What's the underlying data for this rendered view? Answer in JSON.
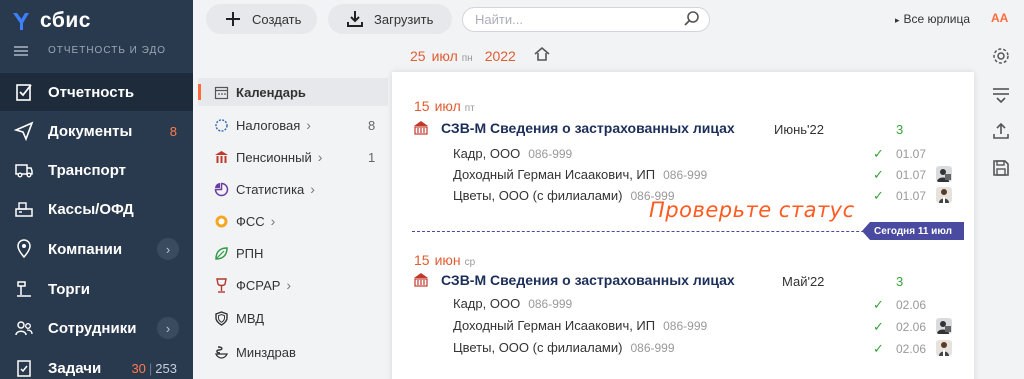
{
  "app": {
    "logo_text": "сбис",
    "section_label": "ОТЧЕТНОСТЬ И ЭДО"
  },
  "sidebar": {
    "items": [
      {
        "label": "Отчетность",
        "icon": "report-icon",
        "active": true
      },
      {
        "label": "Документы",
        "icon": "paper-plane-icon",
        "count": "8"
      },
      {
        "label": "Транспорт",
        "icon": "truck-icon"
      },
      {
        "label": "Кассы/ОФД",
        "icon": "cash-register-icon"
      },
      {
        "label": "Компании",
        "icon": "location-pin-icon",
        "chevron": "›"
      },
      {
        "label": "Торги",
        "icon": "auction-icon"
      },
      {
        "label": "Сотрудники",
        "icon": "people-icon",
        "chevron": "›"
      },
      {
        "label": "Задачи",
        "icon": "tasks-icon",
        "count_a": "30",
        "count_sep": "|",
        "count_b": "253"
      }
    ]
  },
  "toolbar": {
    "create_label": "Создать",
    "upload_label": "Загрузить",
    "search_placeholder": "Найти...",
    "org_filter_label": "Все юрлица",
    "org_filter_arrow": "▸",
    "font_size_label": "AA"
  },
  "current_date": {
    "day": "25",
    "month": "июл",
    "weekday": "пн",
    "year": "2022"
  },
  "categories": [
    {
      "label": "Календарь",
      "icon": "calendar-icon",
      "active": true
    },
    {
      "label": "Налоговая",
      "icon": "tax-icon",
      "chevron": "›",
      "count": "8"
    },
    {
      "label": "Пенсионный",
      "icon": "pension-icon",
      "chevron": "›",
      "count": "1"
    },
    {
      "label": "Статистика",
      "icon": "pie-chart-icon",
      "chevron": "›"
    },
    {
      "label": "ФСС",
      "icon": "fss-icon",
      "chevron": "›"
    },
    {
      "label": "РПН",
      "icon": "leaf-icon"
    },
    {
      "label": "ФСРАР",
      "icon": "goblet-icon",
      "chevron": "›"
    },
    {
      "label": "МВД",
      "icon": "shield-icon"
    },
    {
      "label": "Минздрав",
      "icon": "snake-bowl-icon"
    }
  ],
  "groups": [
    {
      "day": "15",
      "month": "июл",
      "weekday": "пт",
      "doc_title": "СЗВ-М Сведения о застрахованных лицах",
      "period": "Июнь'22",
      "count": "3",
      "rows": [
        {
          "org": "Кадр, ООО",
          "inn": "086-999",
          "check": "✓",
          "date": "01.07"
        },
        {
          "org": "Доходный Герман Исаакович, ИП",
          "inn": "086-999",
          "check": "✓",
          "date": "01.07"
        },
        {
          "org": "Цветы, ООО (с филиалами)",
          "inn": "086-999",
          "check": "✓",
          "date": "01.07"
        }
      ]
    },
    {
      "day": "15",
      "month": "июн",
      "weekday": "ср",
      "doc_title": "СЗВ-М Сведения о застрахованных лицах",
      "period": "Май'22",
      "count": "3",
      "rows": [
        {
          "org": "Кадр, ООО",
          "inn": "086-999",
          "check": "✓",
          "date": "02.06"
        },
        {
          "org": "Доходный Герман Исаакович, ИП",
          "inn": "086-999",
          "check": "✓",
          "date": "02.06"
        },
        {
          "org": "Цветы, ООО (с филиалами)",
          "inn": "086-999",
          "check": "✓",
          "date": "02.06"
        }
      ]
    }
  ],
  "today_badge": "Сегодня 11 июл",
  "hint_text": "Проверьте статус",
  "colors": {
    "accent": "#ff6a3d",
    "sidebar_bg": "#2a3a4e",
    "today_marker": "#4a4aa0",
    "doc_title": "#1c2f5a",
    "ok_green": "#3aa33a"
  }
}
